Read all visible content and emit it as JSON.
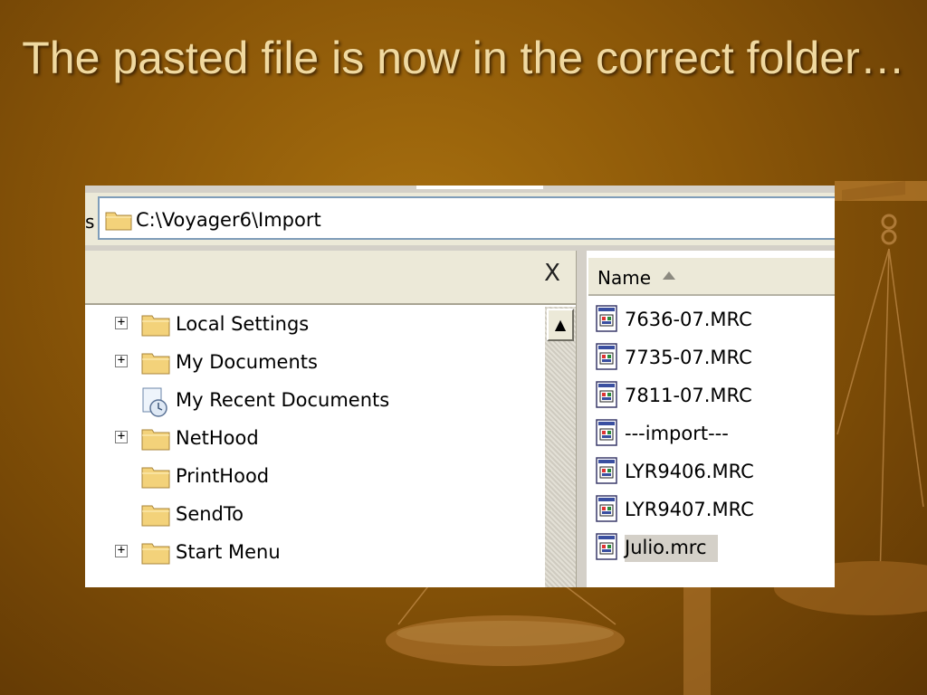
{
  "slide": {
    "title": "The pasted file is now in the correct folder…"
  },
  "explorer": {
    "address_stub": "s",
    "address": "C:\\Voyager6\\Import",
    "close_label": "X",
    "scroll_up_label": "▲",
    "tree": [
      {
        "label": "Local Settings",
        "expandable": true,
        "icon": "folder-icon"
      },
      {
        "label": "My Documents",
        "expandable": true,
        "icon": "folder-icon"
      },
      {
        "label": "My Recent Documents",
        "expandable": false,
        "icon": "recent-documents-icon"
      },
      {
        "label": "NetHood",
        "expandable": true,
        "icon": "folder-icon"
      },
      {
        "label": "PrintHood",
        "expandable": false,
        "icon": "folder-icon"
      },
      {
        "label": "SendTo",
        "expandable": false,
        "icon": "folder-icon"
      },
      {
        "label": "Start Menu",
        "expandable": true,
        "icon": "folder-icon"
      }
    ],
    "files_header": "Name",
    "files": [
      {
        "label": "7636-07.MRC",
        "selected": false
      },
      {
        "label": "7735-07.MRC",
        "selected": false
      },
      {
        "label": "7811-07.MRC",
        "selected": false
      },
      {
        "label": "---import---",
        "selected": false
      },
      {
        "label": "LYR9406.MRC",
        "selected": false
      },
      {
        "label": "LYR9407.MRC",
        "selected": false
      },
      {
        "label": "Julio.mrc",
        "selected": true
      }
    ],
    "expander_glyph": "+"
  },
  "colors": {
    "background": "#8a5608",
    "title_text": "#f0d9a0",
    "selection": "#d4d0c8"
  }
}
